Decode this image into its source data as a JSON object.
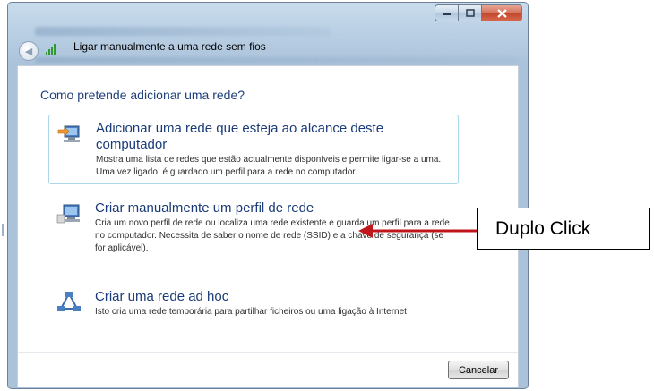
{
  "window": {
    "title": "Ligar manualmente a uma rede sem fios",
    "cancel_label": "Cancelar"
  },
  "question": "Como pretende adicionar uma rede?",
  "options": [
    {
      "title": "Adicionar uma rede que esteja ao alcance deste computador",
      "description": "Mostra uma lista de redes que estão actualmente disponíveis e permite ligar-se a uma. Uma vez ligado, é guardado um perfil para a rede no computador.",
      "icon": "network-add-icon"
    },
    {
      "title": "Criar manualmente um perfil de rede",
      "description": "Cria um novo perfil de rede ou localiza uma rede existente e guarda um perfil para a rede no computador. Necessita de saber o nome de rede (SSID) e a chave de segurança (se for aplicável).",
      "icon": "network-profile-icon"
    },
    {
      "title": "Criar uma rede ad hoc",
      "description": "Isto cria uma rede temporária para partilhar ficheiros ou uma ligação à Internet",
      "icon": "adhoc-network-icon"
    }
  ],
  "annotation": {
    "label": "Duplo Click",
    "arrow_color": "#c0161b"
  },
  "colors": {
    "accent_text": "#1a3b78",
    "selection_border": "#a8d8ea"
  }
}
